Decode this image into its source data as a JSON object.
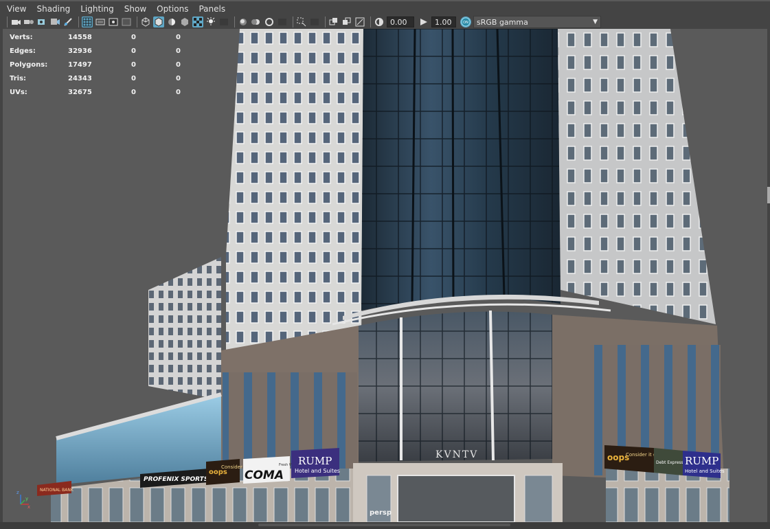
{
  "menu": {
    "items": [
      "View",
      "Shading",
      "Lighting",
      "Show",
      "Options",
      "Panels"
    ]
  },
  "toolbar": {
    "exposure_value": "0.00",
    "gamma_value": "1.00",
    "color_space": "sRGB gamma",
    "icons": [
      "select-camera-icon",
      "camera-attributes-icon",
      "bookmarks-icon",
      "image-plane-icon",
      "2d-pan-zoom-icon",
      "grid-icon",
      "film-gate-icon",
      "resolution-gate-icon",
      "gate-mask-icon",
      "field-chart-icon",
      "safe-action-icon",
      "wireframe-icon",
      "smooth-shade-icon",
      "wireframe-on-shaded-icon",
      "default-material-icon",
      "textured-icon",
      "use-all-lights-icon",
      "shadows-icon",
      "screen-space-ao-icon",
      "motion-blur-icon",
      "anti-aliasing-icon",
      "depth-of-field-icon",
      "isolate-select-icon",
      "xray-icon",
      "xray-joints-icon",
      "xray-active-components-icon",
      "exposure-icon",
      "gamma-icon",
      "color-management-icon"
    ]
  },
  "hud": {
    "rows": [
      {
        "label": "Verts:",
        "v1": "14558",
        "v2": "0",
        "v3": "0"
      },
      {
        "label": "Edges:",
        "v1": "32936",
        "v2": "0",
        "v3": "0"
      },
      {
        "label": "Polygons:",
        "v1": "17497",
        "v2": "0",
        "v3": "0"
      },
      {
        "label": "Tris:",
        "v1": "24343",
        "v2": "0",
        "v3": "0"
      },
      {
        "label": "UVs:",
        "v1": "32675",
        "v2": "0",
        "v3": "0"
      }
    ]
  },
  "viewport": {
    "camera": "persp",
    "background_color": "#5a5a5a",
    "signs": {
      "national_bank": "NATIONAL BANK",
      "profenix": "PROFENIX SPORTSWEAR",
      "oops1": "oops",
      "consider1": "Consider it gone.",
      "coma": "COMA",
      "coma_small": "Fresh Wear",
      "rump1_title": "RUMP",
      "rump1_sub": "Hotel and Suites",
      "kvntv": "KVNTV",
      "oops2": "oops",
      "consider2": "Consider it gone.",
      "debt": "Debt Express",
      "rump2_title": "RUMP",
      "rump2_sub": "Hotel and Suites"
    }
  },
  "axis": {
    "x": "x",
    "y": "y",
    "z": "z"
  }
}
